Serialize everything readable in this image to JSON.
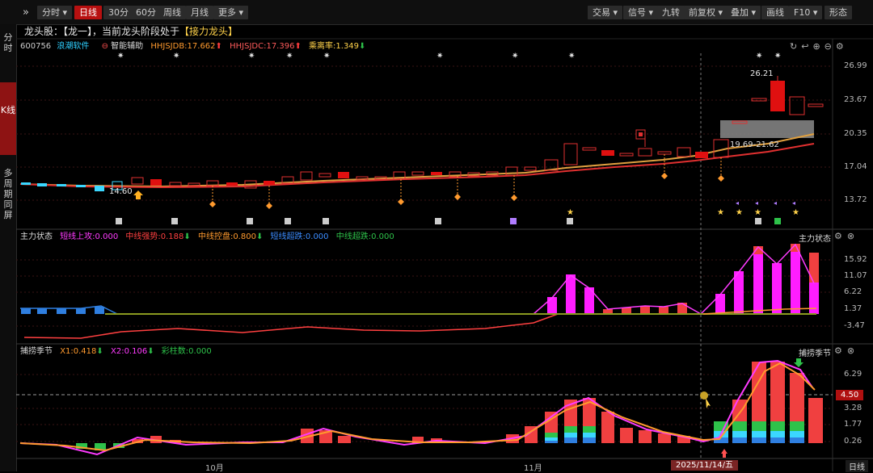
{
  "toolbar": {
    "left": [
      {
        "label": "分时 ▾"
      },
      {
        "label": "日线"
      },
      {
        "label": "30分"
      },
      {
        "label": "60分"
      },
      {
        "label": "周线"
      },
      {
        "label": "月线"
      },
      {
        "label": "更多 ▾"
      }
    ],
    "right": [
      {
        "label": "交易 ▾"
      },
      {
        "label": "信号 ▾"
      },
      {
        "label": "九转"
      },
      {
        "label": "前复权 ▾"
      },
      {
        "label": "叠加 ▾"
      },
      {
        "label": "画线"
      },
      {
        "label": "F10 ▾"
      },
      {
        "label": "形态"
      }
    ]
  },
  "sidebar": [
    {
      "label": "分时"
    },
    {
      "label": "K线"
    },
    {
      "label": "多周期同屏"
    }
  ],
  "banner": {
    "prefix": "龙头股：【龙一】，当前龙头阶段处于",
    "stage": "【接力龙头】"
  },
  "info": {
    "code": "600756",
    "name": "浪潮软件",
    "assist": "智能辅助",
    "hhj1": "HHJSJDB:17.662",
    "hhj2": "HHJSJDC:17.396",
    "ratio": "乘离率:1.349"
  },
  "kline": {
    "price_axis": [
      "26.99",
      "23.67",
      "20.35",
      "17.04",
      "13.72"
    ],
    "low_label": "14.60",
    "high_label": "26.21",
    "zone_label": "19.69-21.62"
  },
  "panel2": {
    "title": "主力状态",
    "legend": [
      {
        "text": "短线上攻:0.000",
        "color": "#ff3bff"
      },
      {
        "text": "中线强势:0.188",
        "color": "#ff4040"
      },
      {
        "text": "中线控盘:0.800",
        "color": "#ff9a2e"
      },
      {
        "text": "短线超跌:0.000",
        "color": "#3b8cff"
      },
      {
        "text": "中线超跌:0.000",
        "color": "#2ec24a"
      }
    ],
    "axis": [
      "15.92",
      "11.07",
      "6.22",
      "1.37",
      "-3.47"
    ]
  },
  "panel3": {
    "title": "捕捞季节",
    "legend": [
      {
        "text": "X1:0.418",
        "color": "#ff9a2e"
      },
      {
        "text": "X2:0.106",
        "color": "#ff3bff"
      },
      {
        "text": "彩柱数:0.000",
        "color": "#2ec24a"
      }
    ],
    "axis": [
      "6.29",
      "3.28",
      "1.77",
      "0.26"
    ],
    "cursor_value": "4.50"
  },
  "x_axis": {
    "labels": [
      "10月",
      "11月"
    ],
    "selected_date": "2025/11/14/五",
    "period": "日线"
  }
}
